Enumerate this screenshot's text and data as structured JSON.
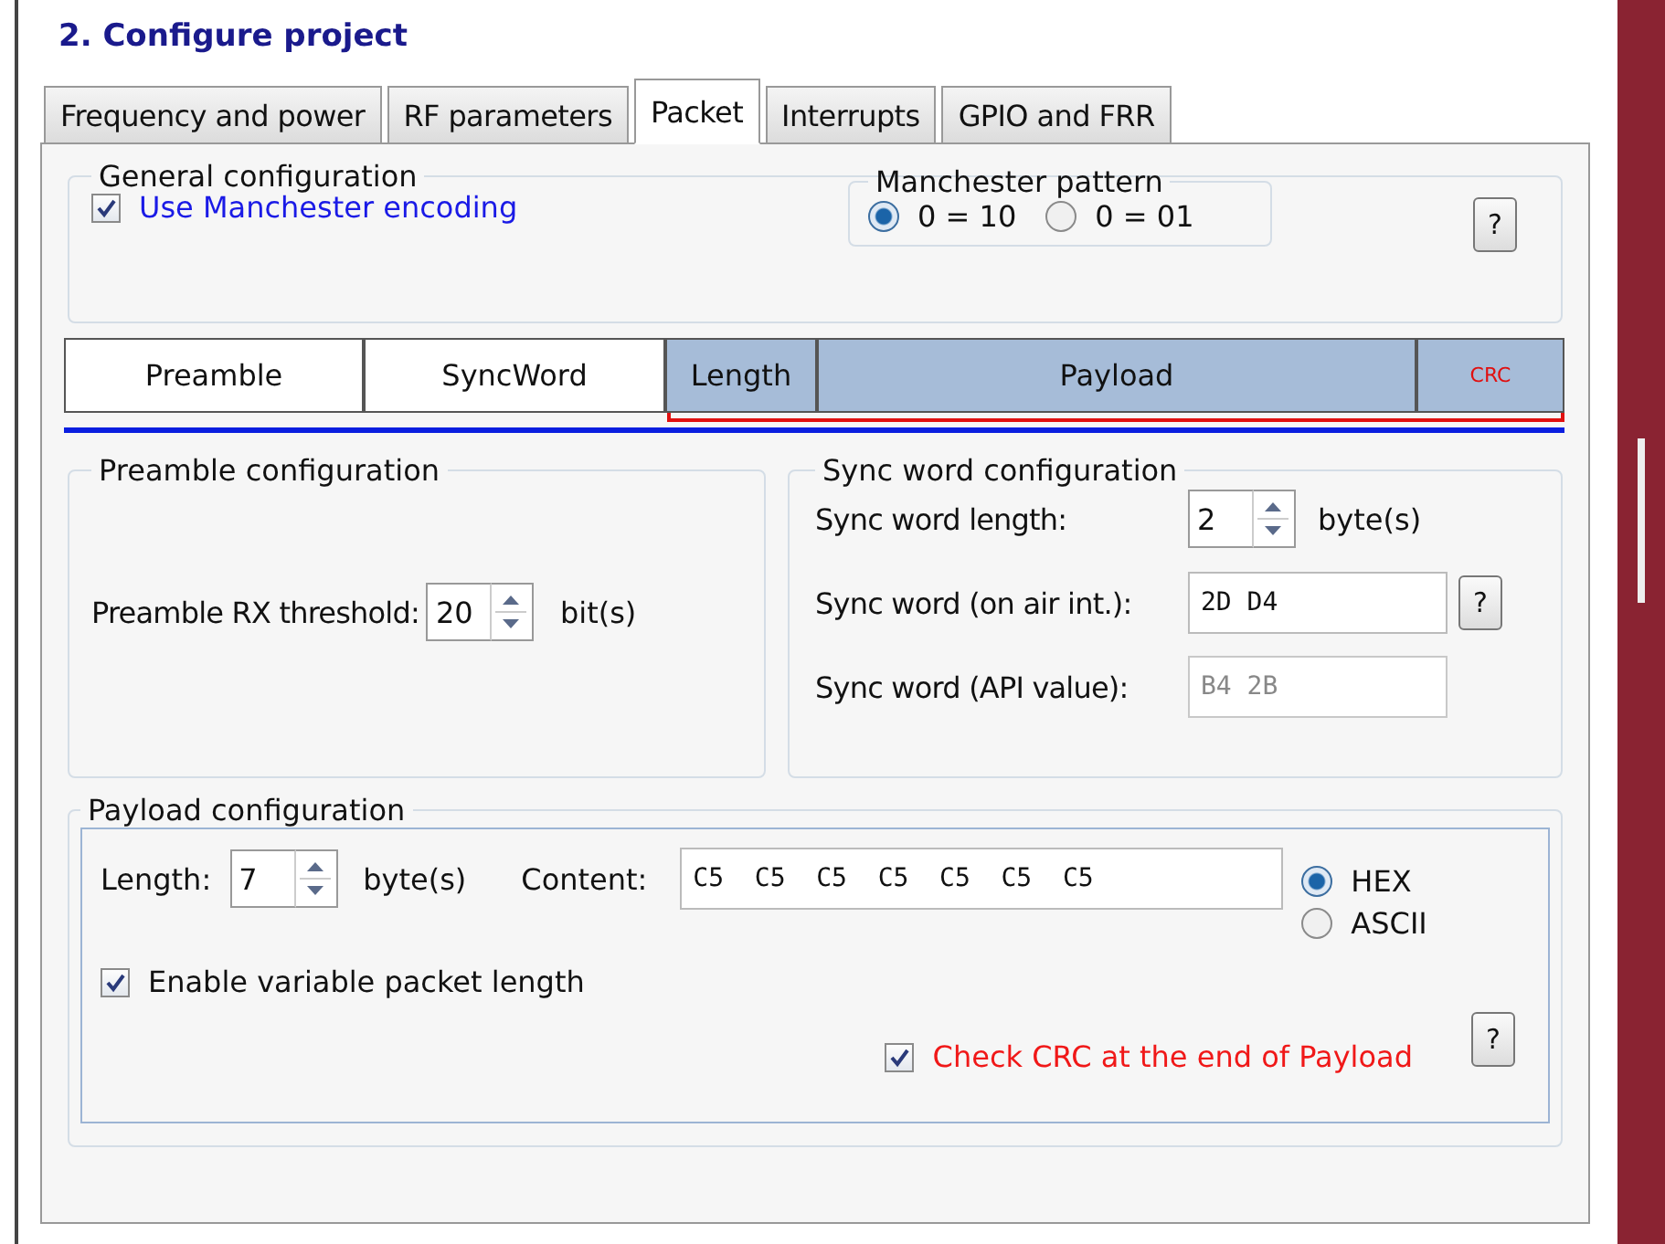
{
  "title": "2. Configure project",
  "tabs": [
    {
      "label": "Frequency and power",
      "selected": false
    },
    {
      "label": "RF parameters",
      "selected": false
    },
    {
      "label": "Packet",
      "selected": true
    },
    {
      "label": "Interrupts",
      "selected": false
    },
    {
      "label": "GPIO and FRR",
      "selected": false
    }
  ],
  "general": {
    "legend": "General configuration",
    "manchester": {
      "label": "Use Manchester encoding",
      "checked": true
    },
    "pattern": {
      "legend": "Manchester pattern",
      "options": [
        {
          "label": "0 = 10",
          "selected": true
        },
        {
          "label": "0 = 01",
          "selected": false
        }
      ]
    },
    "help": "?"
  },
  "packet_fields": [
    {
      "label": "Preamble",
      "kind": "field",
      "highlighted": false
    },
    {
      "label": "SyncWord",
      "kind": "field",
      "highlighted": false
    },
    {
      "label": "Length",
      "kind": "field",
      "highlighted": true
    },
    {
      "label": "Payload",
      "kind": "field",
      "highlighted": true
    },
    {
      "label": "CRC",
      "kind": "crc",
      "highlighted": true
    }
  ],
  "preamble": {
    "legend": "Preamble configuration",
    "label": "Preamble RX threshold:",
    "value": "20",
    "unit": "bit(s)"
  },
  "sync": {
    "legend": "Sync word configuration",
    "rows": [
      {
        "kind": "spinner",
        "label": "Sync word length:",
        "value": "2",
        "unit": "byte(s)"
      },
      {
        "kind": "text",
        "label": "Sync word (on air int.):",
        "value": "2D D4",
        "disabled": false,
        "help": "?"
      },
      {
        "kind": "text",
        "label": "Sync word (API value):",
        "value": "B4 2B",
        "disabled": true
      }
    ]
  },
  "payload": {
    "legend": "Payload configuration",
    "length_label": "Length:",
    "length": "7",
    "unit": "byte(s)",
    "content_label": "Content:",
    "content": "C5 C5 C5 C5 C5 C5 C5",
    "formats": [
      {
        "label": "HEX",
        "selected": true
      },
      {
        "label": "ASCII",
        "selected": false
      }
    ],
    "variable": {
      "label": "Enable variable packet length",
      "checked": true
    },
    "crc": {
      "label": "Check CRC at the end of Payload",
      "checked": true
    },
    "help": "?"
  }
}
